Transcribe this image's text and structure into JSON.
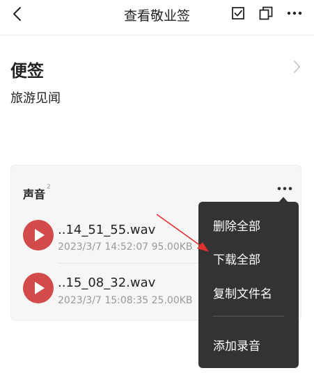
{
  "header": {
    "title": "查看敬业签",
    "back_icon": "back-chevron-icon",
    "icons": [
      "checkbox-icon",
      "copy-icon",
      "more-horizontal-icon"
    ]
  },
  "note": {
    "section_title": "便签",
    "content": "旅游见闻"
  },
  "audio_card": {
    "title": "声音",
    "count": "2",
    "items": [
      {
        "filename": "..14_51_55.wav",
        "meta": "2023/3/7 14:52:07 95.00KB"
      },
      {
        "filename": "..15_08_32.wav",
        "meta": "2023/3/7 15:08:35 25.00KB"
      }
    ]
  },
  "menu": {
    "items": [
      "删除全部",
      "下载全部",
      "复制文件名",
      "添加录音"
    ]
  },
  "colors": {
    "play_button": "#d34a4a",
    "menu_bg": "#333333",
    "annotation_arrow": "#e03030"
  }
}
